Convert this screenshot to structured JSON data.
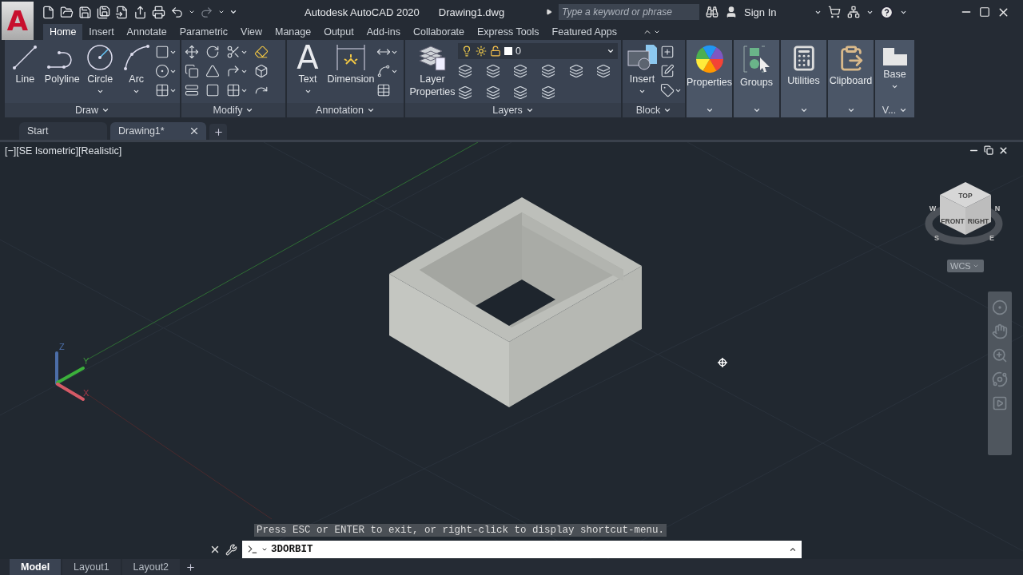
{
  "title_bar": {
    "logo": "A",
    "title": "Autodesk AutoCAD 2020",
    "file_name": "Drawing1.dwg",
    "search": {
      "placeholder": "Type a keyword or phrase"
    },
    "sign_in": "Sign In"
  },
  "ribbon_tabs": [
    {
      "label": "Home",
      "selected": true
    },
    {
      "label": "Insert",
      "selected": false
    },
    {
      "label": "Annotate",
      "selected": false
    },
    {
      "label": "Parametric",
      "selected": false
    },
    {
      "label": "View",
      "selected": false
    },
    {
      "label": "Manage",
      "selected": false
    },
    {
      "label": "Output",
      "selected": false
    },
    {
      "label": "Add-ins",
      "selected": false
    },
    {
      "label": "Collaborate",
      "selected": false
    },
    {
      "label": "Express Tools",
      "selected": false
    },
    {
      "label": "Featured Apps",
      "selected": false
    }
  ],
  "ribbon_panels": [
    {
      "kind": "draw",
      "title": "Draw",
      "tools": [
        {
          "label": "Line",
          "menu": false
        },
        {
          "label": "Polyline",
          "menu": false
        },
        {
          "label": "Circle",
          "menu": true
        },
        {
          "label": "Arc",
          "menu": true
        }
      ]
    },
    {
      "kind": "modify",
      "title": "Modify"
    },
    {
      "kind": "annotation",
      "title": "Annotation",
      "tools": [
        {
          "label": "Text",
          "glyph": "A",
          "menu": true
        },
        {
          "label": "Dimension",
          "menu": false
        }
      ]
    },
    {
      "kind": "layers",
      "title": "Layers",
      "tools": [
        {
          "label": "Layer Properties",
          "menu": false
        }
      ],
      "layer": "0"
    },
    {
      "kind": "block",
      "title": "Block",
      "tools": [
        {
          "label": "Insert",
          "menu": true
        }
      ]
    },
    {
      "kind": "collapsed",
      "label": "Properties"
    },
    {
      "kind": "collapsed",
      "label": "Groups"
    },
    {
      "kind": "collapsed",
      "label": "Utilities"
    },
    {
      "kind": "collapsed",
      "label": "Clipboard"
    },
    {
      "kind": "view",
      "title": "V...",
      "tools": [
        {
          "label": "Base",
          "menu": true
        }
      ]
    }
  ],
  "file_tabs": [
    {
      "label": "Start",
      "selected": false
    },
    {
      "label": "Drawing1*",
      "selected": true
    }
  ],
  "viewport": {
    "label": "[−][SE Isometric][Realistic]",
    "viewcube": {
      "top": "TOP",
      "front": "FRONT",
      "right": "RIGHT",
      "north": "N",
      "south": "S",
      "east": "E",
      "west": "W"
    },
    "wcs": "WCS",
    "ucs": {
      "x": "X",
      "y": "Y",
      "z": "Z"
    }
  },
  "command": {
    "prompt": "Press ESC or ENTER to exit, or right-click to display shortcut-menu.",
    "value": "3DORBIT"
  },
  "layout_tabs": [
    {
      "label": "Model",
      "selected": true
    },
    {
      "label": "Layout1",
      "selected": false
    },
    {
      "label": "Layout2",
      "selected": false
    }
  ]
}
